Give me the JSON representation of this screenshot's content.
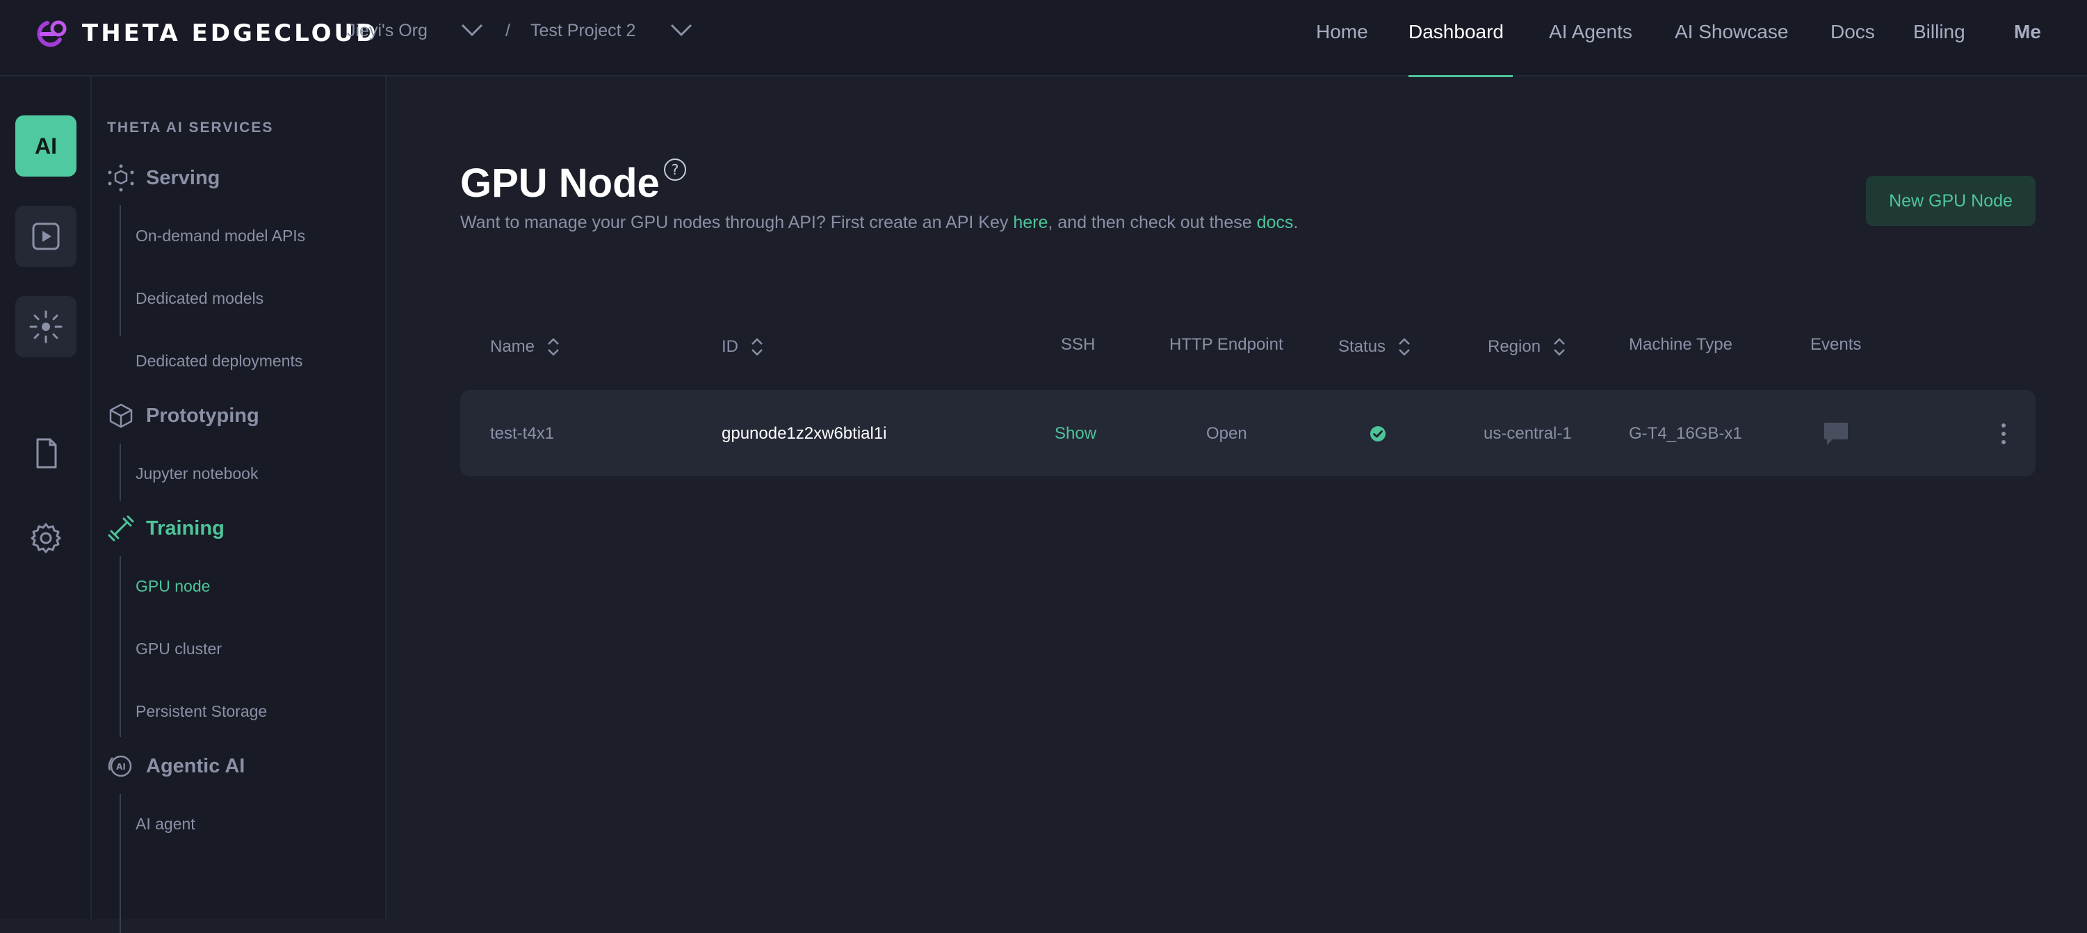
{
  "topbar": {
    "brand": "THETA EDGECLOUD",
    "org": "Jieyi's Org",
    "separator": "/",
    "project": "Test Project 2",
    "nav": [
      "Home",
      "Dashboard",
      "AI Agents",
      "AI Showcase",
      "Docs",
      "Billing",
      "Me"
    ],
    "active_nav": "Dashboard"
  },
  "rail": {
    "ai_label": "AI"
  },
  "sidebar": {
    "section_title": "THETA AI SERVICES",
    "groups": [
      {
        "label": "Serving",
        "icon": "cube-network-icon",
        "items": [
          "On-demand model APIs",
          "Dedicated models",
          "Dedicated deployments"
        ]
      },
      {
        "label": "Prototyping",
        "icon": "cube-icon",
        "items": [
          "Jupyter notebook"
        ]
      },
      {
        "label": "Training",
        "icon": "dumbbell-icon",
        "items": [
          "GPU node",
          "GPU cluster",
          "Persistent Storage"
        ]
      },
      {
        "label": "Agentic AI",
        "icon": "ai-cloud-icon",
        "items": [
          "AI agent"
        ]
      }
    ],
    "active_item": "GPU node"
  },
  "page": {
    "title": "GPU Node",
    "subtitle_pre": "Want to manage your GPU nodes through API? First create an API Key ",
    "subtitle_link1": "here",
    "subtitle_mid": ", and then check out these ",
    "subtitle_link2": "docs",
    "subtitle_end": ".",
    "new_button": "New GPU Node"
  },
  "table": {
    "headers": {
      "name": "Name",
      "id": "ID",
      "ssh": "SSH",
      "http": "HTTP Endpoint",
      "status": "Status",
      "region": "Region",
      "machine": "Machine Type",
      "events": "Events"
    },
    "rows": [
      {
        "name": "test-t4x1",
        "id": "gpunode1z2xw6btial1i",
        "ssh": "Show",
        "http": "Open",
        "status": "running",
        "region": "us-central-1",
        "machine": "G-T4_16GB-x1"
      }
    ]
  },
  "colors": {
    "accent": "#4ec49a",
    "background": "#1c1f2a",
    "panel": "#181b25",
    "brand_logo": "#a23cd8"
  }
}
